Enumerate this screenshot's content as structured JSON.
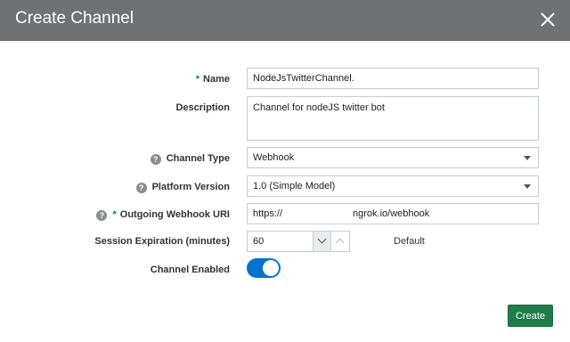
{
  "dialog": {
    "title": "Create Channel",
    "close_icon": "close-icon"
  },
  "form": {
    "required_marker": "*",
    "help_icon_glyph": "?",
    "name": {
      "label": "Name",
      "value": "NodeJsTwitterChannel."
    },
    "description": {
      "label": "Description",
      "value": "Channel for nodeJS twitter bot"
    },
    "channel_type": {
      "label": "Channel Type",
      "value": "Webhook"
    },
    "platform_version": {
      "label": "Platform Version",
      "value": "1.0 (Simple Model)"
    },
    "outgoing_webhook_uri": {
      "label": "Outgoing Webhook URI",
      "value_prefix": "https://",
      "value_suffix": "ngrok.io/webhook"
    },
    "session_expiration": {
      "label": "Session Expiration (minutes)",
      "value": "60",
      "default_label": "Default"
    },
    "channel_enabled": {
      "label": "Channel Enabled",
      "enabled": true
    }
  },
  "footer": {
    "create_label": "Create"
  },
  "colors": {
    "header": "#6e7275",
    "accent": "#0572ce",
    "create_button": "#1e7e4a"
  }
}
